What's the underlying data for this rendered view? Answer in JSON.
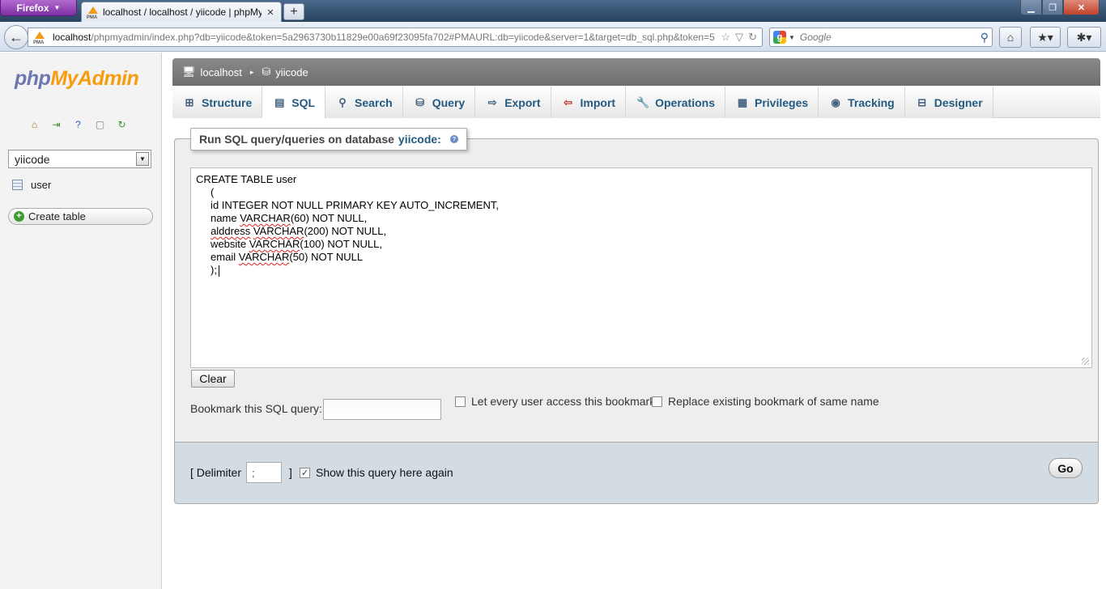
{
  "browser": {
    "menu_label": "Firefox",
    "tab_title": "localhost / localhost / yiicode | phpMyA...",
    "favicon_text": "PMA",
    "url_host": "localhost",
    "url_rest": "/phpmyadmin/index.php?db=yiicode&token=5a2963730b11829e00a69f23095fa702#PMAURL:db=yiicode&server=1&target=db_sql.php&token=5",
    "search_placeholder": "Google"
  },
  "sidebar": {
    "logo_php": "php",
    "logo_myadmin": "MyAdmin",
    "selected_database": "yiicode",
    "tables": [
      "user"
    ],
    "create_table_label": "Create table"
  },
  "breadcrumb": {
    "server": "localhost",
    "database": "yiicode"
  },
  "tabs": [
    {
      "label": "Structure",
      "icon": "structure-icon",
      "active": false
    },
    {
      "label": "SQL",
      "icon": "sql-icon",
      "active": true
    },
    {
      "label": "Search",
      "icon": "search-icon",
      "active": false
    },
    {
      "label": "Query",
      "icon": "query-icon",
      "active": false
    },
    {
      "label": "Export",
      "icon": "export-icon",
      "active": false
    },
    {
      "label": "Import",
      "icon": "import-icon",
      "active": false
    },
    {
      "label": "Operations",
      "icon": "wrench-icon",
      "active": false
    },
    {
      "label": "Privileges",
      "icon": "privileges-icon",
      "active": false
    },
    {
      "label": "Tracking",
      "icon": "eye-icon",
      "active": false
    },
    {
      "label": "Designer",
      "icon": "designer-icon",
      "active": false
    }
  ],
  "sql_panel": {
    "legend_prefix": "Run SQL query/queries on database",
    "legend_db": "yiicode:",
    "query_lines": [
      "CREATE TABLE user",
      "     (",
      "     id INTEGER NOT NULL PRIMARY KEY AUTO_INCREMENT,",
      "     name VARCHAR(60) NOT NULL,",
      "     alddress VARCHAR(200) NOT NULL,",
      "     website VARCHAR(100) NOT NULL,",
      "     email VARCHAR(50) NOT NULL",
      "     );"
    ],
    "clear_label": "Clear",
    "bookmark_label": "Bookmark this SQL query:",
    "bookmark_value": "",
    "let_every_user_label": "Let every user access this bookmark",
    "let_every_user_checked": false,
    "replace_bookmark_label": "Replace existing bookmark of same name",
    "replace_bookmark_checked": false
  },
  "go_panel": {
    "delimiter_open": "[ Delimiter",
    "delimiter_value": ";",
    "delimiter_close": "]",
    "show_query_label": "Show this query here again",
    "show_query_checked": true,
    "go_label": "Go"
  },
  "colors": {
    "link_blue": "#235a81",
    "logo_php": "#6c78af",
    "logo_myadmin": "#f89c0e",
    "go_panel_bg": "#d3dce3"
  }
}
